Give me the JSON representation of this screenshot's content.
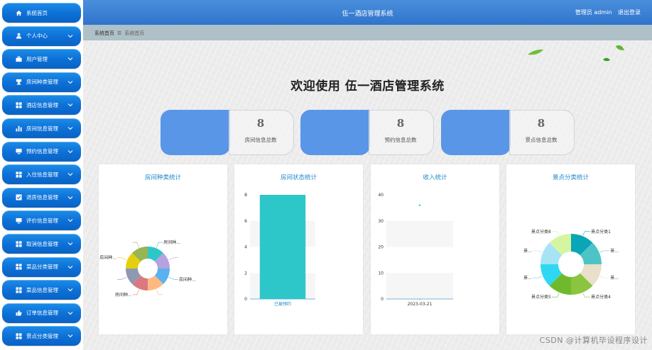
{
  "sidebar": {
    "items": [
      {
        "label": "系统首页",
        "icon": "home-icon",
        "chevron": false
      },
      {
        "label": "个人中心",
        "icon": "user-icon",
        "chevron": true
      },
      {
        "label": "用户管理",
        "icon": "briefcase-icon",
        "chevron": true
      },
      {
        "label": "房间种类管理",
        "icon": "cup-icon",
        "chevron": true
      },
      {
        "label": "酒店信息管理",
        "icon": "grid-icon",
        "chevron": true
      },
      {
        "label": "房间信息管理",
        "icon": "bar-chart-icon",
        "chevron": true
      },
      {
        "label": "预约信息管理",
        "icon": "monitor-icon",
        "chevron": true
      },
      {
        "label": "入住信息管理",
        "icon": "grid-icon",
        "chevron": true
      },
      {
        "label": "退房信息管理",
        "icon": "checkbox-icon",
        "chevron": true
      },
      {
        "label": "评价信息管理",
        "icon": "monitor-icon",
        "chevron": true
      },
      {
        "label": "取消信息管理",
        "icon": "grid-icon",
        "chevron": true
      },
      {
        "label": "菜品分类管理",
        "icon": "grid-icon",
        "chevron": true
      },
      {
        "label": "菜品信息管理",
        "icon": "grid-icon",
        "chevron": true
      },
      {
        "label": "订单信息管理",
        "icon": "thumb-icon",
        "chevron": true
      },
      {
        "label": "景点分类管理",
        "icon": "grid-icon",
        "chevron": true
      }
    ]
  },
  "header": {
    "title": "伍一酒店管理系统",
    "user": "管理员 admin",
    "logout": "退出登录"
  },
  "breadcrumb": {
    "home": "系统首页",
    "sep": "☰",
    "current": "系统首页"
  },
  "welcome": "欢迎使用 伍一酒店管理系统",
  "stats": [
    {
      "value": "8",
      "label": "房间信息总数"
    },
    {
      "value": "8",
      "label": "预约信息总数"
    },
    {
      "value": "8",
      "label": "景点信息总数"
    }
  ],
  "colors": {
    "accent": "#1e88c7",
    "sidebar": "#0c6fd6",
    "header": "#2f74cc",
    "bar": "#2ec7c9"
  },
  "chart_data": [
    {
      "type": "pie",
      "title": "房间种类统计",
      "donut": true,
      "categories": [
        "房间种...",
        "房间种...",
        "房间种...",
        "房间种...",
        "房间种...",
        "房间种...",
        "房间种...",
        "房间种..."
      ],
      "values": [
        1,
        1,
        1,
        1,
        1,
        1,
        1,
        1
      ],
      "colors": [
        "#2ec7c9",
        "#b6a2de",
        "#5ab1ef",
        "#ffb980",
        "#d87a80",
        "#8d98b3",
        "#e5cf0d",
        "#97b552"
      ],
      "shown_labels": [
        {
          "slice": 0,
          "text": "房间种..."
        },
        {
          "slice": 2,
          "text": "房间种..."
        },
        {
          "slice": 4,
          "text": "房间种..."
        },
        {
          "slice": 6,
          "text": "房间种..."
        }
      ]
    },
    {
      "type": "bar",
      "title": "房间状态统计",
      "categories": [
        "已被预约"
      ],
      "values": [
        8
      ],
      "ylim": [
        0,
        8
      ],
      "yticks": [
        0,
        2,
        4,
        6,
        8
      ],
      "color": "#2ec7c9"
    },
    {
      "type": "line",
      "title": "收入统计",
      "categories": [
        "2023-03-21"
      ],
      "values": [
        36
      ],
      "ylim": [
        0,
        40
      ],
      "yticks": [
        0,
        10,
        20,
        30,
        40
      ],
      "color": "#2ec7c9"
    },
    {
      "type": "pie",
      "title": "景点分类统计",
      "donut": true,
      "categories": [
        "景点分类1",
        "景...",
        "景...",
        "景点分类4",
        "景点分类5",
        "景...",
        "景...",
        "景点分类8"
      ],
      "values": [
        1,
        1,
        1,
        1,
        1,
        1,
        1,
        1
      ],
      "colors": [
        "#0aa6b8",
        "#4ec3c6",
        "#eadfc8",
        "#8bc43f",
        "#6fba2c",
        "#2fd8f2",
        "#a6e4f5",
        "#d6f5a0"
      ]
    }
  ],
  "watermark": "CSDN @计算机毕设程序设计"
}
